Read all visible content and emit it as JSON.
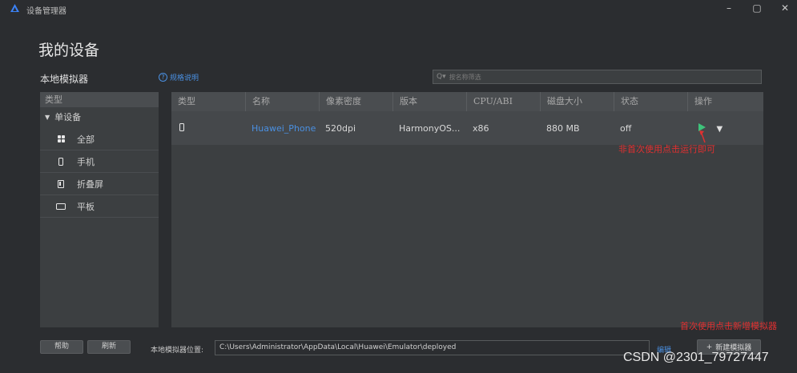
{
  "window": {
    "title": "设备管理器",
    "minimize": "–",
    "maximize": "▢",
    "close": "✕"
  },
  "page": {
    "title": "我的设备"
  },
  "section": {
    "title": "本地模拟器",
    "help_link": "规格说明",
    "search_placeholder": "按名称筛选"
  },
  "sidebar": {
    "header": "类型",
    "group": "单设备",
    "items": [
      {
        "label": "全部",
        "icon": "grid-icon"
      },
      {
        "label": "手机",
        "icon": "phone-icon"
      },
      {
        "label": "折叠屏",
        "icon": "foldable-icon"
      },
      {
        "label": "平板",
        "icon": "tablet-icon"
      }
    ]
  },
  "table": {
    "columns": [
      "类型",
      "名称",
      "像素密度",
      "版本",
      "CPU/ABI",
      "磁盘大小",
      "状态",
      "操作"
    ],
    "rows": [
      {
        "type_icon": "phone-icon",
        "name": "Huawei_Phone",
        "density": "520dpi",
        "version": "HarmonyOS...",
        "cpu": "x86",
        "disk": "880 MB",
        "status": "off"
      }
    ]
  },
  "annotations": {
    "run_hint": "非首次使用点击运行即可",
    "new_hint": "首次使用点击新增模拟器",
    "color": "#e03030"
  },
  "footer": {
    "help_button": "帮助",
    "refresh_button": "刷新",
    "location_label": "本地模拟器位置:",
    "location_value": "C:\\Users\\Administrator\\AppData\\Local\\Huawei\\Emulator\\deployed",
    "edit_link": "编辑",
    "new_button": "新建模拟器",
    "new_button_icon": "+"
  },
  "watermark": "CSDN @2301_79727447",
  "colors": {
    "background": "#2b2d30",
    "panel": "#3c3f41",
    "link": "#4a90e2",
    "run": "#3ec27a"
  }
}
